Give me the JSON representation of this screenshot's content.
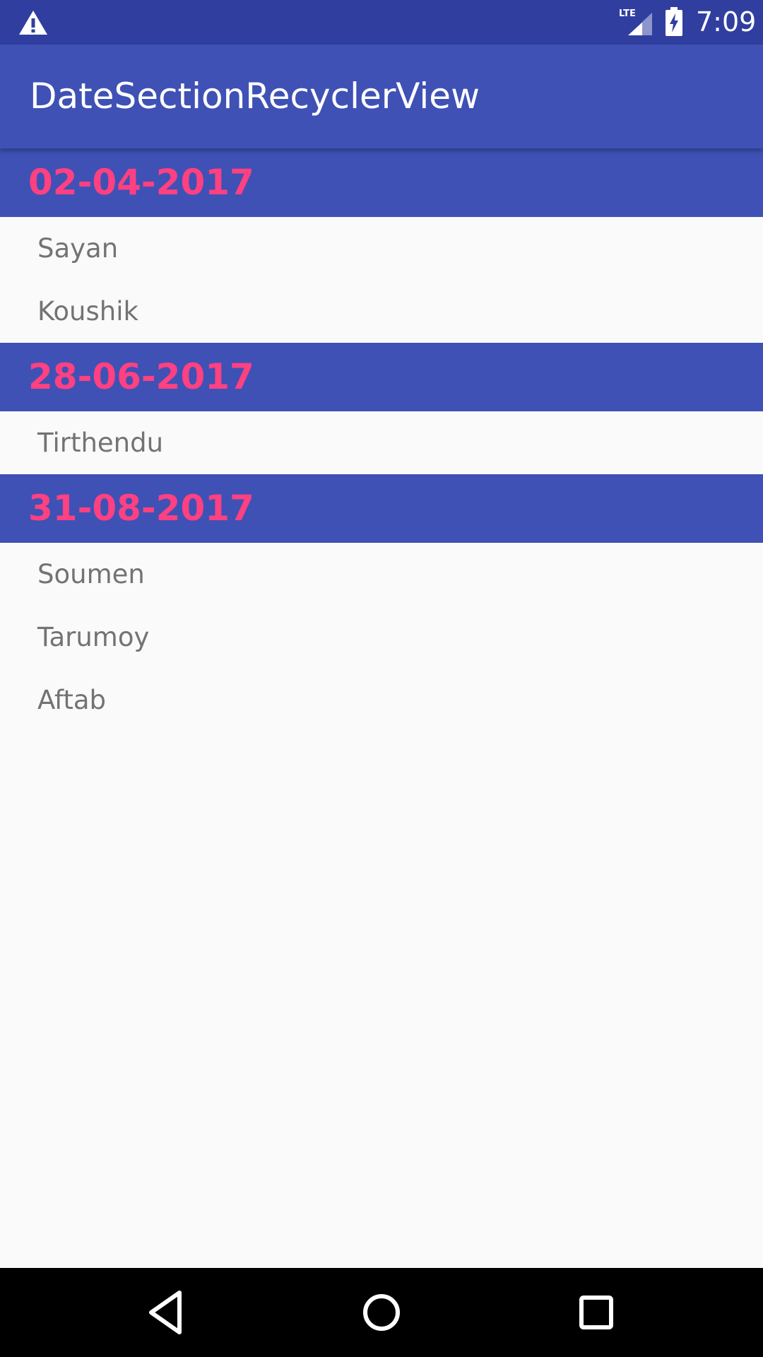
{
  "status_bar": {
    "time": "7:09",
    "icons": [
      "warning-icon",
      "lte-signal-icon",
      "battery-charging-icon"
    ],
    "lte_label": "LTE"
  },
  "app_bar": {
    "title": "DateSectionRecyclerView"
  },
  "sections": [
    {
      "date": "02-04-2017",
      "items": [
        "Sayan",
        "Koushik"
      ]
    },
    {
      "date": "28-06-2017",
      "items": [
        "Tirthendu"
      ]
    },
    {
      "date": "31-08-2017",
      "items": [
        "Soumen",
        "Tarumoy",
        "Aftab"
      ]
    }
  ],
  "nav_bar": {
    "icons": [
      "back-icon",
      "home-icon",
      "recents-icon"
    ]
  },
  "colors": {
    "primary": "#3f51b5",
    "primary_dark": "#303f9f",
    "accent": "#ff4081",
    "item_text": "#737373",
    "background": "#fafafa"
  }
}
